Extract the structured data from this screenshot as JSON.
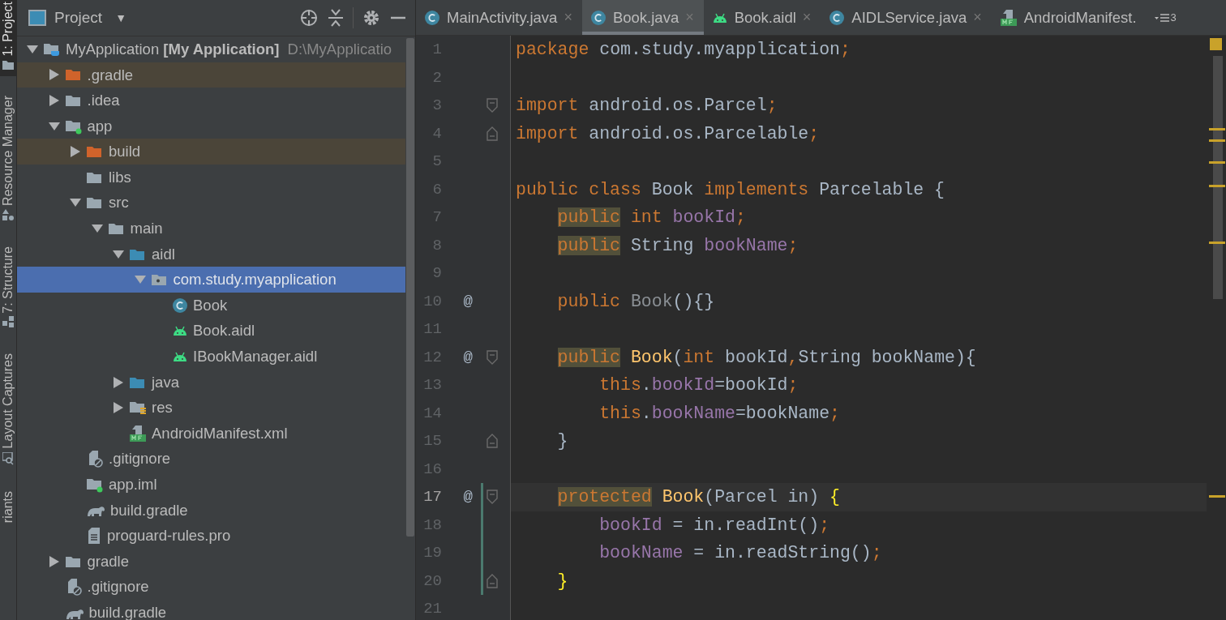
{
  "tool_strip": [
    {
      "label": "1: Project",
      "kind": "folder",
      "selected": true
    },
    {
      "label": "Resource Manager",
      "kind": "shapes",
      "selected": false
    },
    {
      "label": "7: Structure",
      "kind": "structure",
      "selected": false
    },
    {
      "label": "Layout Captures",
      "kind": "inspector",
      "selected": false
    },
    {
      "label": "riants",
      "selected": false
    }
  ],
  "project_panel": {
    "title": "Project",
    "caret": "▼"
  },
  "tree": [
    {
      "label": "MyApplication **[My Application]**",
      "path": "D:\\MyApplicatio",
      "kind": "project",
      "expanded": true,
      "selected": false,
      "excluded": false,
      "children": [
        {
          "label": ".gradle",
          "kind": "folder-excluded",
          "expanded": false,
          "selected": false,
          "excluded": true
        },
        {
          "label": ".idea",
          "kind": "folder",
          "expanded": false,
          "selected": false,
          "excluded": false
        },
        {
          "label": "app",
          "kind": "module",
          "expanded": true,
          "selected": false,
          "excluded": false,
          "children": [
            {
              "label": "build",
              "kind": "folder-excluded",
              "expanded": false,
              "selected": false,
              "excluded": true
            },
            {
              "label": "libs",
              "kind": "folder",
              "selected": false,
              "excluded": false
            },
            {
              "label": "src",
              "kind": "folder",
              "expanded": true,
              "selected": false,
              "excluded": false,
              "children": [
                {
                  "label": "main",
                  "kind": "folder",
                  "expanded": true,
                  "selected": false,
                  "excluded": false,
                  "children": [
                    {
                      "label": "aidl",
                      "kind": "folder-source",
                      "expanded": true,
                      "selected": false,
                      "excluded": false,
                      "children": [
                        {
                          "label": "com.study.myapplication",
                          "kind": "package",
                          "expanded": true,
                          "selected": true,
                          "excluded": false,
                          "children": [
                            {
                              "label": "Book",
                              "kind": "class",
                              "selected": false,
                              "excluded": false
                            },
                            {
                              "label": "Book.aidl",
                              "kind": "android",
                              "selected": false,
                              "excluded": false
                            },
                            {
                              "label": "IBookManager.aidl",
                              "kind": "android",
                              "selected": false,
                              "excluded": false
                            }
                          ]
                        }
                      ]
                    },
                    {
                      "label": "java",
                      "kind": "folder-source",
                      "expanded": false,
                      "selected": false,
                      "excluded": false
                    },
                    {
                      "label": "res",
                      "kind": "res",
                      "expanded": false,
                      "selected": false,
                      "excluded": false
                    },
                    {
                      "label": "AndroidManifest.xml",
                      "kind": "manifest",
                      "selected": false,
                      "excluded": false
                    }
                  ]
                }
              ]
            },
            {
              "label": ".gitignore",
              "kind": "ignore",
              "selected": false,
              "excluded": false
            },
            {
              "label": "app.iml",
              "kind": "module",
              "selected": false,
              "excluded": false
            },
            {
              "label": "build.gradle",
              "kind": "gradle",
              "selected": false,
              "excluded": false
            },
            {
              "label": "proguard-rules.pro",
              "kind": "text",
              "selected": false,
              "excluded": false
            }
          ]
        },
        {
          "label": "gradle",
          "kind": "folder",
          "expanded": false,
          "selected": false,
          "excluded": false
        },
        {
          "label": ".gitignore",
          "kind": "ignore",
          "selected": false,
          "excluded": false
        },
        {
          "label": "build.gradle",
          "kind": "gradle",
          "selected": false,
          "excluded": false
        }
      ]
    }
  ],
  "tabs": [
    {
      "label": "MainActivity.java",
      "kind": "class",
      "close": "×",
      "selected": false
    },
    {
      "label": "Book.java",
      "kind": "class",
      "close": "×",
      "selected": true
    },
    {
      "label": "Book.aidl",
      "kind": "android",
      "close": "×",
      "selected": false
    },
    {
      "label": "AIDLService.java",
      "kind": "class",
      "close": "×",
      "selected": false
    },
    {
      "label": "AndroidManifest.",
      "kind": "manifest",
      "selected": false
    }
  ],
  "overflow_count": "3",
  "lines": [
    {
      "n": "1",
      "tokens": [
        {
          "kind": "kw",
          "t": "package"
        },
        {
          "kind": "plain",
          "t": " com.study.myapplication"
        },
        {
          "kind": "kw",
          "t": ";"
        }
      ]
    },
    {
      "n": "2"
    },
    {
      "n": "3",
      "fold": {
        "kind": "start"
      },
      "tokens": [
        {
          "kind": "kw",
          "t": "import"
        },
        {
          "kind": "plain",
          "t": " android.os.Parcel"
        },
        {
          "kind": "kw",
          "t": ";"
        }
      ]
    },
    {
      "n": "4",
      "fold": {
        "kind": "end"
      },
      "tokens": [
        {
          "kind": "kw",
          "t": "import"
        },
        {
          "kind": "plain",
          "t": " android.os.Parcelable"
        },
        {
          "kind": "kw",
          "t": ";"
        }
      ]
    },
    {
      "n": "5"
    },
    {
      "n": "6",
      "tokens": [
        {
          "kind": "kw",
          "t": "public class "
        },
        {
          "kind": "plain",
          "t": "Book "
        },
        {
          "kind": "kw",
          "t": "implements "
        },
        {
          "kind": "plain",
          "t": "Parcelable {"
        }
      ]
    },
    {
      "n": "7",
      "tokens": [
        {
          "kind": "kw",
          "t": "    public",
          "hl": true
        },
        {
          "kind": "kw",
          "t": " int "
        },
        {
          "kind": "field",
          "t": "bookId"
        },
        {
          "kind": "kw",
          "t": ";"
        }
      ]
    },
    {
      "n": "8",
      "tokens": [
        {
          "kind": "kw",
          "t": "    public",
          "hl": true
        },
        {
          "kind": "plain",
          "t": " String "
        },
        {
          "kind": "field",
          "t": "bookName"
        },
        {
          "kind": "kw",
          "t": ";"
        }
      ]
    },
    {
      "n": "9"
    },
    {
      "n": "10",
      "marker": "@",
      "tokens": [
        {
          "kind": "kw",
          "t": "    public "
        },
        {
          "kind": "unused",
          "t": "Book"
        },
        {
          "kind": "plain",
          "t": "(){}"
        }
      ]
    },
    {
      "n": "11"
    },
    {
      "n": "12",
      "marker": "@",
      "fold": {
        "kind": "start"
      },
      "tokens": [
        {
          "kind": "kw",
          "t": "    public",
          "hl": true
        },
        {
          "kind": "fn",
          "t": " Book"
        },
        {
          "kind": "plain",
          "t": "("
        },
        {
          "kind": "kw",
          "t": "int"
        },
        {
          "kind": "plain",
          "t": " bookId"
        },
        {
          "kind": "kw",
          "t": ","
        },
        {
          "kind": "plain",
          "t": "String bookName){"
        }
      ]
    },
    {
      "n": "13",
      "tokens": [
        {
          "kind": "kw",
          "t": "        this"
        },
        {
          "kind": "plain",
          "t": "."
        },
        {
          "kind": "field",
          "t": "bookId"
        },
        {
          "kind": "plain",
          "t": "=bookId"
        },
        {
          "kind": "kw",
          "t": ";"
        }
      ]
    },
    {
      "n": "14",
      "tokens": [
        {
          "kind": "kw",
          "t": "        this"
        },
        {
          "kind": "plain",
          "t": "."
        },
        {
          "kind": "field",
          "t": "bookName"
        },
        {
          "kind": "plain",
          "t": "=bookName"
        },
        {
          "kind": "kw",
          "t": ";"
        }
      ]
    },
    {
      "n": "15",
      "fold": {
        "kind": "end"
      },
      "tokens": [
        {
          "kind": "plain",
          "t": "    }"
        }
      ]
    },
    {
      "n": "16"
    },
    {
      "n": "17",
      "marker": "@",
      "fold": {
        "kind": "start"
      },
      "current": true,
      "changed": true,
      "tokens": [
        {
          "kind": "kw",
          "t": "    protected",
          "hl": true
        },
        {
          "kind": "fn",
          "t": " Book"
        },
        {
          "kind": "plain",
          "t": "(Parcel in) "
        },
        {
          "kind": "brace",
          "t": "{"
        }
      ]
    },
    {
      "n": "18",
      "changed": true,
      "tokens": [
        {
          "kind": "field",
          "t": "        bookId"
        },
        {
          "kind": "plain",
          "t": " = in.readInt()"
        },
        {
          "kind": "kw",
          "t": ";"
        }
      ]
    },
    {
      "n": "19",
      "changed": true,
      "tokens": [
        {
          "kind": "field",
          "t": "        bookName"
        },
        {
          "kind": "plain",
          "t": " = in.readString()"
        },
        {
          "kind": "kw",
          "t": ";"
        }
      ]
    },
    {
      "n": "20",
      "fold": {
        "kind": "end"
      },
      "changed": true,
      "tokens": [
        {
          "kind": "brace",
          "t": "    }"
        }
      ]
    },
    {
      "n": "21"
    }
  ]
}
